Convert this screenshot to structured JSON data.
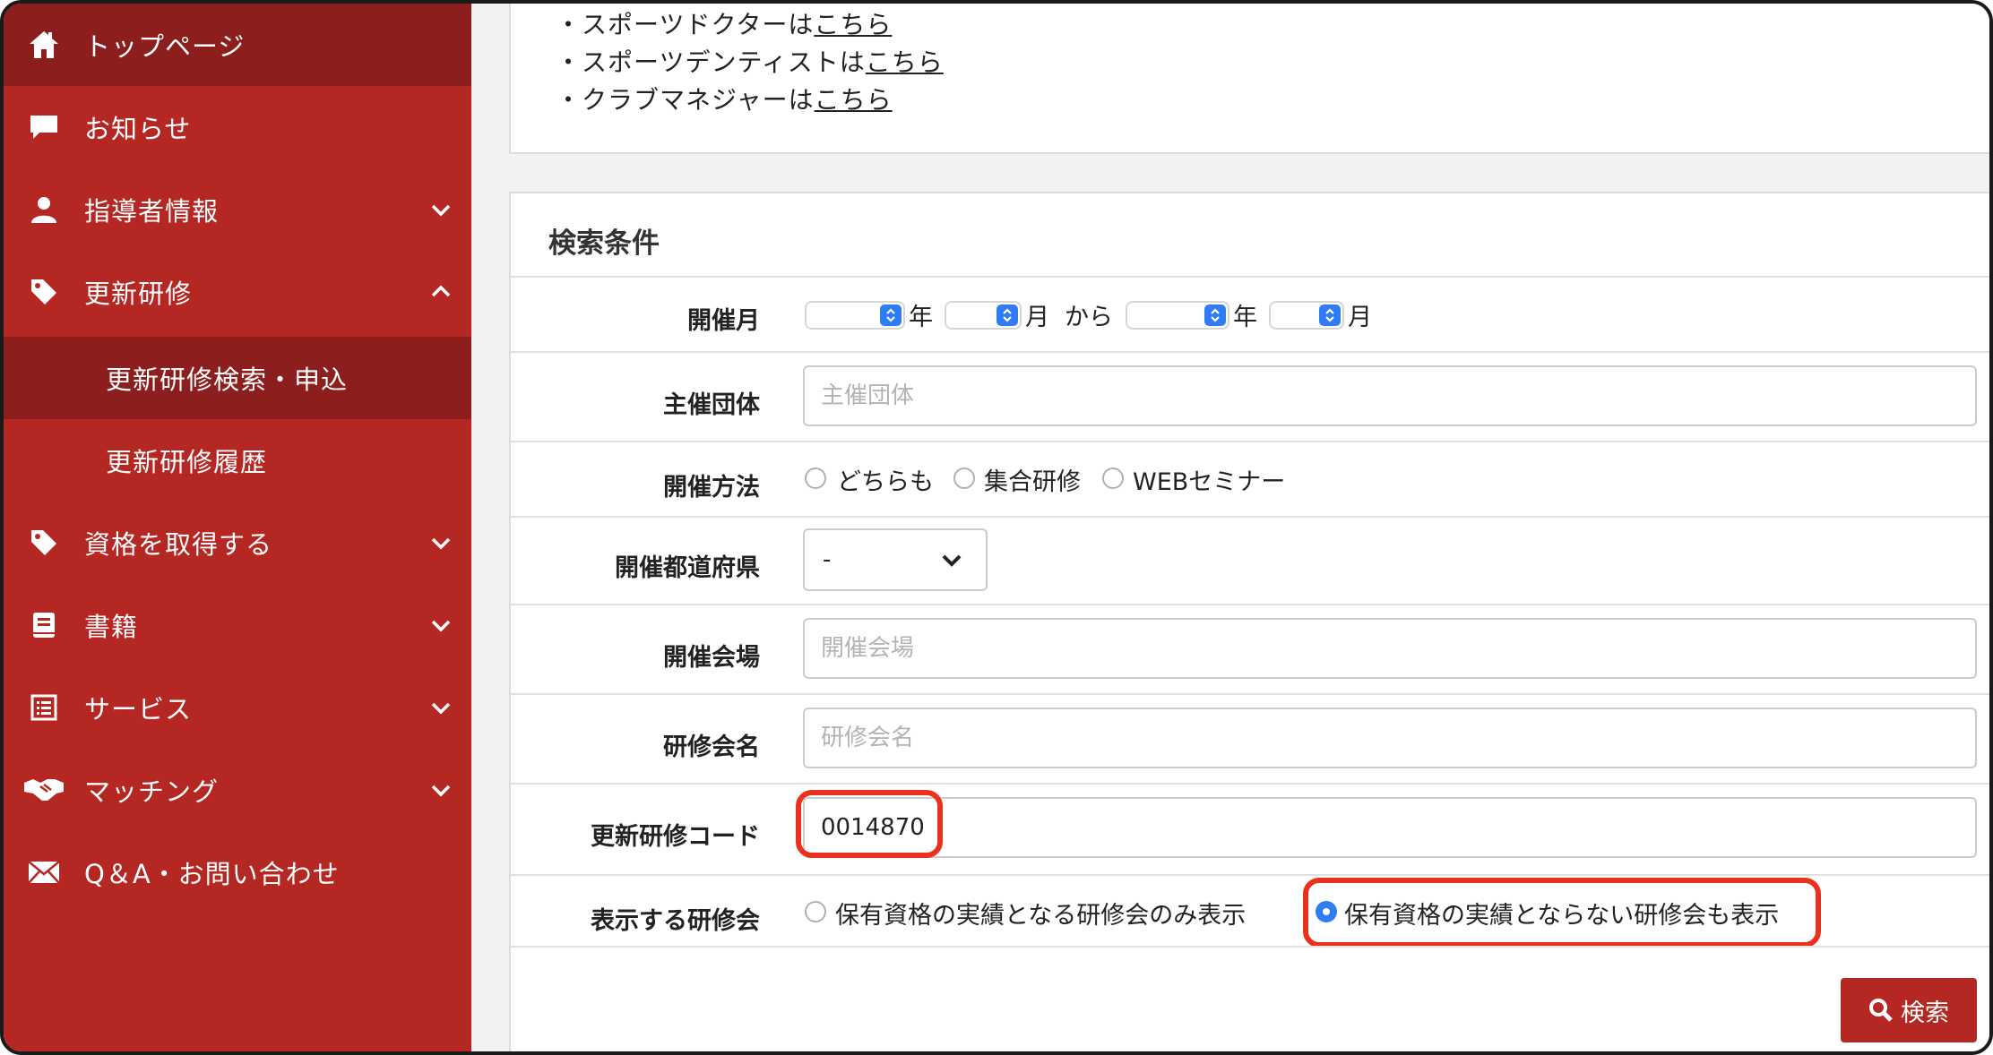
{
  "sidebar": {
    "items": [
      {
        "label": "トップページ",
        "icon": "home-icon"
      },
      {
        "label": "お知らせ",
        "icon": "chat-bubble-icon"
      },
      {
        "label": "指導者情報",
        "icon": "user-icon"
      },
      {
        "label": "更新研修",
        "icon": "tag-icon"
      },
      {
        "label": "更新研修検索・申込"
      },
      {
        "label": "更新研修履歴"
      },
      {
        "label": "資格を取得する",
        "icon": "tag-icon"
      },
      {
        "label": "書籍",
        "icon": "book-icon"
      },
      {
        "label": "サービス",
        "icon": "list-icon"
      },
      {
        "label": "マッチング",
        "icon": "handshake-icon"
      },
      {
        "label": "Q＆A・お問い合わせ",
        "icon": "envelope-icon"
      }
    ]
  },
  "links": [
    {
      "prefix": "・スポーツドクターは",
      "link": "こちら"
    },
    {
      "prefix": "・スポーツデンティストは",
      "link": "こちら"
    },
    {
      "prefix": "・クラブマネジャーは",
      "link": "こちら"
    }
  ],
  "search": {
    "title": "検索条件",
    "month_label": "開催月",
    "year_unit": "年",
    "month_unit": "月",
    "from_text": "から",
    "organizer_label": "主催団体",
    "organizer_placeholder": "主催団体",
    "method_label": "開催方法",
    "method_options": [
      "どちらも",
      "集合研修",
      "WEBセミナー"
    ],
    "prefecture_label": "開催都道府県",
    "prefecture_value": "-",
    "venue_label": "開催会場",
    "venue_placeholder": "開催会場",
    "name_label": "研修会名",
    "name_placeholder": "研修会名",
    "code_label": "更新研修コード",
    "code_value": "0014870",
    "display_label": "表示する研修会",
    "display_options": [
      "保有資格の実績となる研修会のみ表示",
      "保有資格の実績とならない研修会も表示"
    ],
    "display_selected": 1,
    "button_label": "検索"
  },
  "colors": {
    "sidebar": "#b52722",
    "sidebar_active": "#8c1f1d",
    "highlight": "#e8321e",
    "accent": "#2f7cf5"
  }
}
